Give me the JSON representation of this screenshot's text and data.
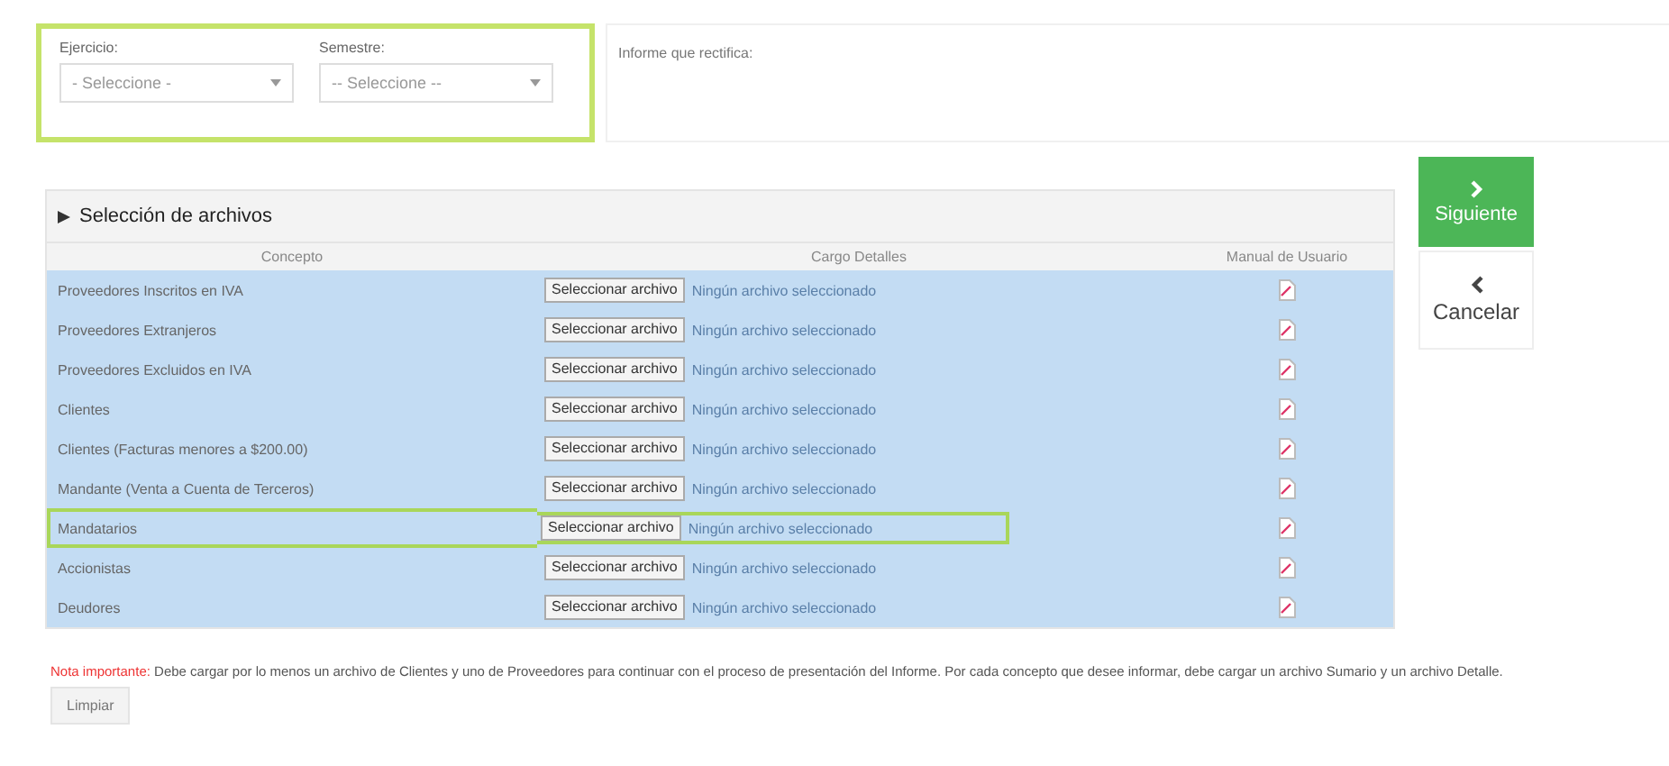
{
  "filters": {
    "highlighted": true,
    "fields": [
      {
        "label": "Ejercicio:",
        "value": "- Seleccione -"
      },
      {
        "label": "Semestre:",
        "value": "-- Seleccione --"
      }
    ]
  },
  "rectify_label": "Informe que rectifica:",
  "files_panel": {
    "title": "Selección de archivos",
    "expanded": true,
    "columns": [
      "Concepto",
      "Cargo Detalles",
      "Manual de Usuario"
    ],
    "rows": [
      {
        "concept": "Proveedores Inscritos en IVA",
        "button": "Seleccionar archivo",
        "file_status": "Ningún archivo seleccionado",
        "highlighted": false
      },
      {
        "concept": "Proveedores Extranjeros",
        "button": "Seleccionar archivo",
        "file_status": "Ningún archivo seleccionado",
        "highlighted": false
      },
      {
        "concept": "Proveedores Excluidos en IVA",
        "button": "Seleccionar archivo",
        "file_status": "Ningún archivo seleccionado",
        "highlighted": false
      },
      {
        "concept": "Clientes",
        "button": "Seleccionar archivo",
        "file_status": "Ningún archivo seleccionado",
        "highlighted": false
      },
      {
        "concept": "Clientes (Facturas menores a $200.00)",
        "button": "Seleccionar archivo",
        "file_status": "Ningún archivo seleccionado",
        "highlighted": false
      },
      {
        "concept": "Mandante (Venta a Cuenta de Terceros)",
        "button": "Seleccionar archivo",
        "file_status": "Ningún archivo seleccionado",
        "highlighted": false
      },
      {
        "concept": "Mandatarios",
        "button": "Seleccionar archivo",
        "file_status": "Ningún archivo seleccionado",
        "highlighted": true
      },
      {
        "concept": "Accionistas",
        "button": "Seleccionar archivo",
        "file_status": "Ningún archivo seleccionado",
        "highlighted": false
      },
      {
        "concept": "Deudores",
        "button": "Seleccionar archivo",
        "file_status": "Ningún archivo seleccionado",
        "highlighted": false
      }
    ]
  },
  "actions": [
    {
      "kind": "next",
      "label": "Siguiente"
    },
    {
      "kind": "cancel",
      "label": "Cancelar"
    }
  ],
  "note": "**Nota importante:** Debe cargar por lo menos un archivo de Clientes y uno de Proveedores para continuar con el proceso de presentación del Informe. Por cada concepto que desee informar, debe cargar un archivo Sumario y un archivo Detalle.",
  "clear_button": "Limpiar"
}
